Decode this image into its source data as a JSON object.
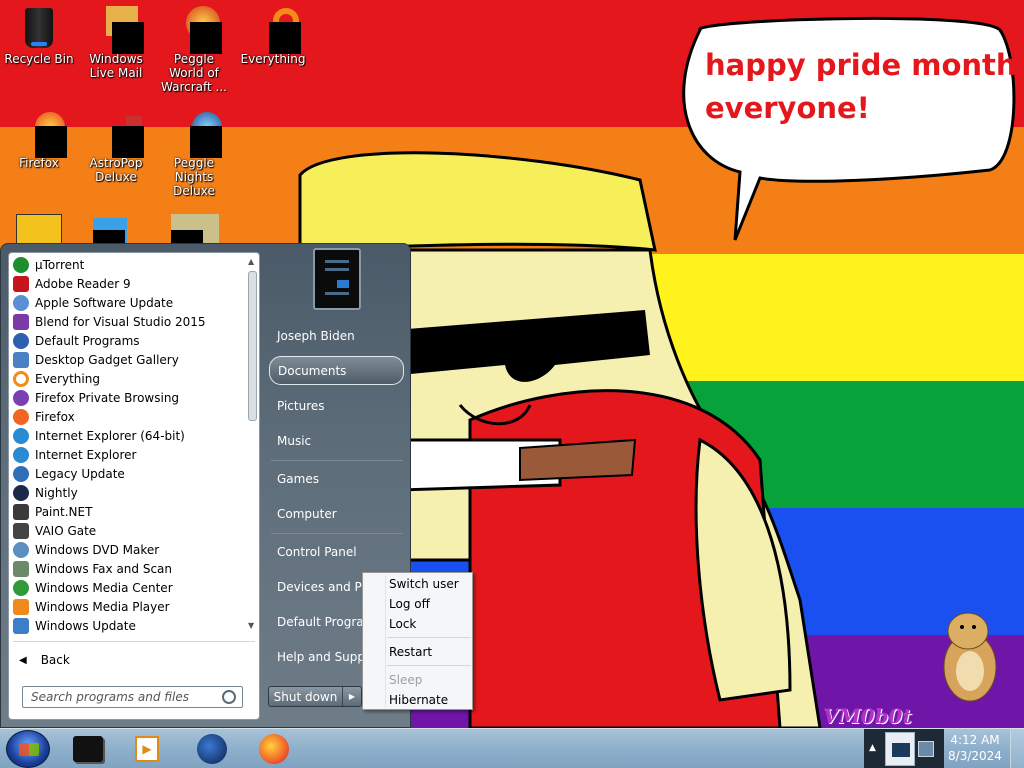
{
  "wallpaper": {
    "colors": {
      "red": "#e4181c",
      "orange": "#f57f17",
      "yellow": "#fff21d",
      "green": "#07a33a",
      "blue": "#1a4ff0",
      "purple": "#6f16a8"
    },
    "speech_text_line1": "happy pride month",
    "speech_text_line2": "everyone!",
    "watermark": "VM0b0t"
  },
  "desktop_icons": [
    {
      "label": "Recycle Bin",
      "icon": "recycle-bin-icon"
    },
    {
      "label": "Windows Live Mail",
      "icon": "mail-icon"
    },
    {
      "label": "Peggle World of Warcraft ...",
      "icon": "peggle-icon"
    },
    {
      "label": "Everything",
      "icon": "search-icon"
    },
    {
      "label": "Firefox",
      "icon": "firefox-icon"
    },
    {
      "label": "AstroPop Deluxe",
      "icon": "astropop-icon"
    },
    {
      "label": "Peggle Nights Deluxe",
      "icon": "peggle-nights-icon"
    }
  ],
  "start_menu": {
    "programs": [
      {
        "label": "µTorrent",
        "color": "#1b8f2c"
      },
      {
        "label": "Adobe Reader 9",
        "color": "#c4161c"
      },
      {
        "label": "Apple Software Update",
        "color": "#5b8fd6"
      },
      {
        "label": "Blend for Visual Studio 2015",
        "color": "#7a3aa8"
      },
      {
        "label": "Default Programs",
        "color": "#2f5fb0"
      },
      {
        "label": "Desktop Gadget Gallery",
        "color": "#4c7fc4"
      },
      {
        "label": "Everything",
        "color": "#f28b17"
      },
      {
        "label": "Firefox Private Browsing",
        "color": "#7c3fb3"
      },
      {
        "label": "Firefox",
        "color": "#f26522"
      },
      {
        "label": "Internet Explorer (64-bit)",
        "color": "#2a8ad4"
      },
      {
        "label": "Internet Explorer",
        "color": "#2a8ad4"
      },
      {
        "label": "Legacy Update",
        "color": "#2e6fb8"
      },
      {
        "label": "Nightly",
        "color": "#1c2a4a"
      },
      {
        "label": "Paint.NET",
        "color": "#3a3a3a"
      },
      {
        "label": "VAIO Gate",
        "color": "#444444"
      },
      {
        "label": "Windows DVD Maker",
        "color": "#5a8fc0"
      },
      {
        "label": "Windows Fax and Scan",
        "color": "#6a8a6a"
      },
      {
        "label": "Windows Media Center",
        "color": "#2f9a3a"
      },
      {
        "label": "Windows Media Player",
        "color": "#f08a1d"
      },
      {
        "label": "Windows Update",
        "color": "#3a7fc8"
      }
    ],
    "back_label": "Back",
    "search_placeholder": "Search programs and files",
    "right_items": [
      "Joseph Biden",
      "Documents",
      "Pictures",
      "Music",
      "Games",
      "Computer",
      "Control Panel",
      "Devices and Printers",
      "Default Programs",
      "Help and Support"
    ],
    "shutdown_label": "Shut down"
  },
  "shutdown_menu": {
    "items": [
      "Switch user",
      "Log off",
      "Lock",
      "Restart",
      "Sleep",
      "Hibernate"
    ]
  },
  "taskbar": {
    "time": "4:12 AM",
    "date": "8/3/2024"
  }
}
